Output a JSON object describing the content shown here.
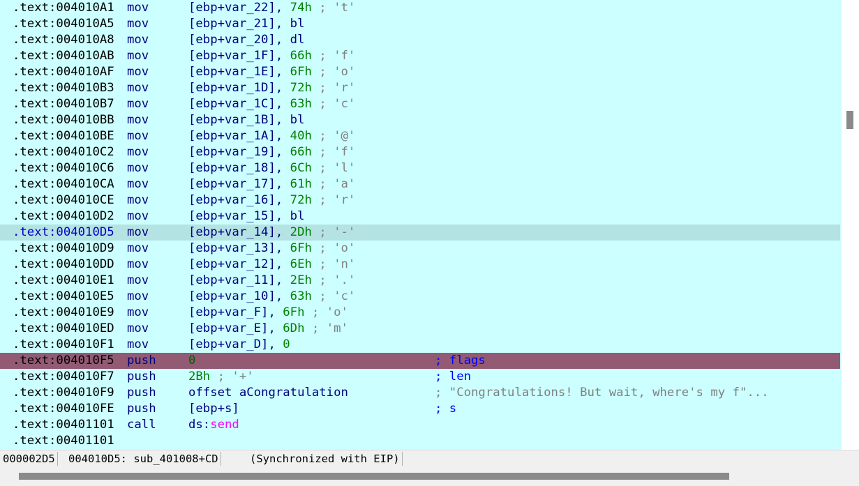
{
  "listing": [
    {
      "addr": ".text:004010A1",
      "mn": "mov",
      "op": "[ebp+var_22]",
      "val": "74h",
      "chr": "; 't'"
    },
    {
      "addr": ".text:004010A5",
      "mn": "mov",
      "op": "[ebp+var_21]",
      "reg": "bl"
    },
    {
      "addr": ".text:004010A8",
      "mn": "mov",
      "op": "[ebp+var_20]",
      "reg": "dl"
    },
    {
      "addr": ".text:004010AB",
      "mn": "mov",
      "op": "[ebp+var_1F]",
      "val": "66h",
      "chr": "; 'f'"
    },
    {
      "addr": ".text:004010AF",
      "mn": "mov",
      "op": "[ebp+var_1E]",
      "val": "6Fh",
      "chr": "; 'o'"
    },
    {
      "addr": ".text:004010B3",
      "mn": "mov",
      "op": "[ebp+var_1D]",
      "val": "72h",
      "chr": "; 'r'"
    },
    {
      "addr": ".text:004010B7",
      "mn": "mov",
      "op": "[ebp+var_1C]",
      "val": "63h",
      "chr": "; 'c'"
    },
    {
      "addr": ".text:004010BB",
      "mn": "mov",
      "op": "[ebp+var_1B]",
      "reg": "bl"
    },
    {
      "addr": ".text:004010BE",
      "mn": "mov",
      "op": "[ebp+var_1A]",
      "val": "40h",
      "chr": "; '@'"
    },
    {
      "addr": ".text:004010C2",
      "mn": "mov",
      "op": "[ebp+var_19]",
      "val": "66h",
      "chr": "; 'f'"
    },
    {
      "addr": ".text:004010C6",
      "mn": "mov",
      "op": "[ebp+var_18]",
      "val": "6Ch",
      "chr": "; 'l'"
    },
    {
      "addr": ".text:004010CA",
      "mn": "mov",
      "op": "[ebp+var_17]",
      "val": "61h",
      "chr": "; 'a'"
    },
    {
      "addr": ".text:004010CE",
      "mn": "mov",
      "op": "[ebp+var_16]",
      "val": "72h",
      "chr": "; 'r'"
    },
    {
      "addr": ".text:004010D2",
      "mn": "mov",
      "op": "[ebp+var_15]",
      "reg": "bl"
    },
    {
      "addr": ".text:004010D5",
      "mn": "mov",
      "op": "[ebp+var_14]",
      "val": "2Dh",
      "chr": "; '-'",
      "highlight": "cursor"
    },
    {
      "addr": ".text:004010D9",
      "mn": "mov",
      "op": "[ebp+var_13]",
      "val": "6Fh",
      "chr": "; 'o'"
    },
    {
      "addr": ".text:004010DD",
      "mn": "mov",
      "op": "[ebp+var_12]",
      "val": "6Eh",
      "chr": "; 'n'"
    },
    {
      "addr": ".text:004010E1",
      "mn": "mov",
      "op": "[ebp+var_11]",
      "val": "2Eh",
      "chr": "; '.'"
    },
    {
      "addr": ".text:004010E5",
      "mn": "mov",
      "op": "[ebp+var_10]",
      "val": "63h",
      "chr": "; 'c'"
    },
    {
      "addr": ".text:004010E9",
      "mn": "mov",
      "op": "[ebp+var_F]",
      "val": "6Fh",
      "chr": "; 'o'"
    },
    {
      "addr": ".text:004010ED",
      "mn": "mov",
      "op": "[ebp+var_E]",
      "val": "6Dh",
      "chr": "; 'm'"
    },
    {
      "addr": ".text:004010F1",
      "mn": "mov",
      "op": "[ebp+var_D]",
      "val": "0"
    },
    {
      "addr": ".text:004010F5",
      "mn": "push",
      "val0": "0",
      "rcmt": "; flags",
      "highlight": "eip"
    },
    {
      "addr": ".text:004010F7",
      "mn": "push",
      "val0": "2Bh",
      "chr0": "; '+'",
      "rcmt": "; len"
    },
    {
      "addr": ".text:004010F9",
      "mn": "push",
      "name": "offset aCongratulation",
      "rcmt": "; \"Congratulations! But wait, where's my f\"...",
      "rcmtGray": true
    },
    {
      "addr": ".text:004010FE",
      "mn": "push",
      "name": "[ebp+s]",
      "rcmt": "; s"
    },
    {
      "addr": ".text:00401101",
      "mn": "call",
      "seg": "ds:",
      "imp": "send"
    },
    {
      "addr": ".text:00401101",
      "mn": ""
    }
  ],
  "status": {
    "offset": "000002D5",
    "location": "004010D5: sub_401008+CD",
    "sync": "(Synchronized with EIP)"
  },
  "colors": {
    "background": "#ccffff",
    "cursor_line": "#b5e3e3",
    "eip_line": "#925a73",
    "number": "#008000",
    "mnemonic": "#000080",
    "comment": "#808080",
    "import": "#ff00ff"
  }
}
